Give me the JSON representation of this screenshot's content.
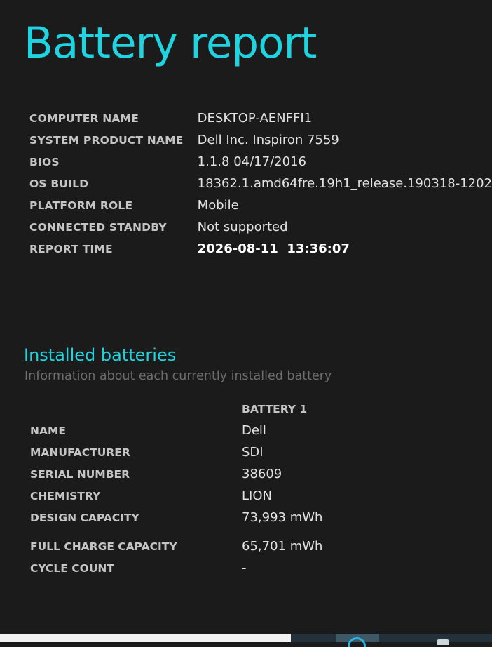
{
  "title": "Battery report",
  "system_info": [
    {
      "label": "COMPUTER NAME",
      "value": "DESKTOP-AENFFI1"
    },
    {
      "label": "SYSTEM PRODUCT NAME",
      "value": "Dell Inc. Inspiron 7559"
    },
    {
      "label": "BIOS",
      "value": "1.1.8 04/17/2016"
    },
    {
      "label": "OS BUILD",
      "value": "18362.1.amd64fre.19h1_release.190318-1202"
    },
    {
      "label": "PLATFORM ROLE",
      "value": "Mobile"
    },
    {
      "label": "CONNECTED STANDBY",
      "value": "Not supported"
    },
    {
      "label": "REPORT TIME",
      "value": "2026-08-11  13:36:07"
    }
  ],
  "installed_batteries": {
    "title": "Installed batteries",
    "subtitle": "Information about each currently installed battery",
    "column_header": "BATTERY 1",
    "rows": [
      {
        "label": "NAME",
        "value": "Dell"
      },
      {
        "label": "MANUFACTURER",
        "value": "SDI"
      },
      {
        "label": "SERIAL NUMBER",
        "value": "38609"
      },
      {
        "label": "CHEMISTRY",
        "value": "LION"
      },
      {
        "label": "DESIGN CAPACITY",
        "value": "73,993 mWh"
      },
      {
        "label": "FULL CHARGE CAPACITY",
        "value": "65,701 mWh"
      },
      {
        "label": "CYCLE COUNT",
        "value": "-"
      }
    ]
  },
  "colors": {
    "background": "#1b1b1b",
    "accent": "#1fd3e0",
    "label": "#c4c4c4",
    "value": "#e2e2e2",
    "subtitle": "#6d6d6d"
  },
  "taskbar": {
    "icons": [
      "edge-icon",
      "app-icon"
    ]
  }
}
